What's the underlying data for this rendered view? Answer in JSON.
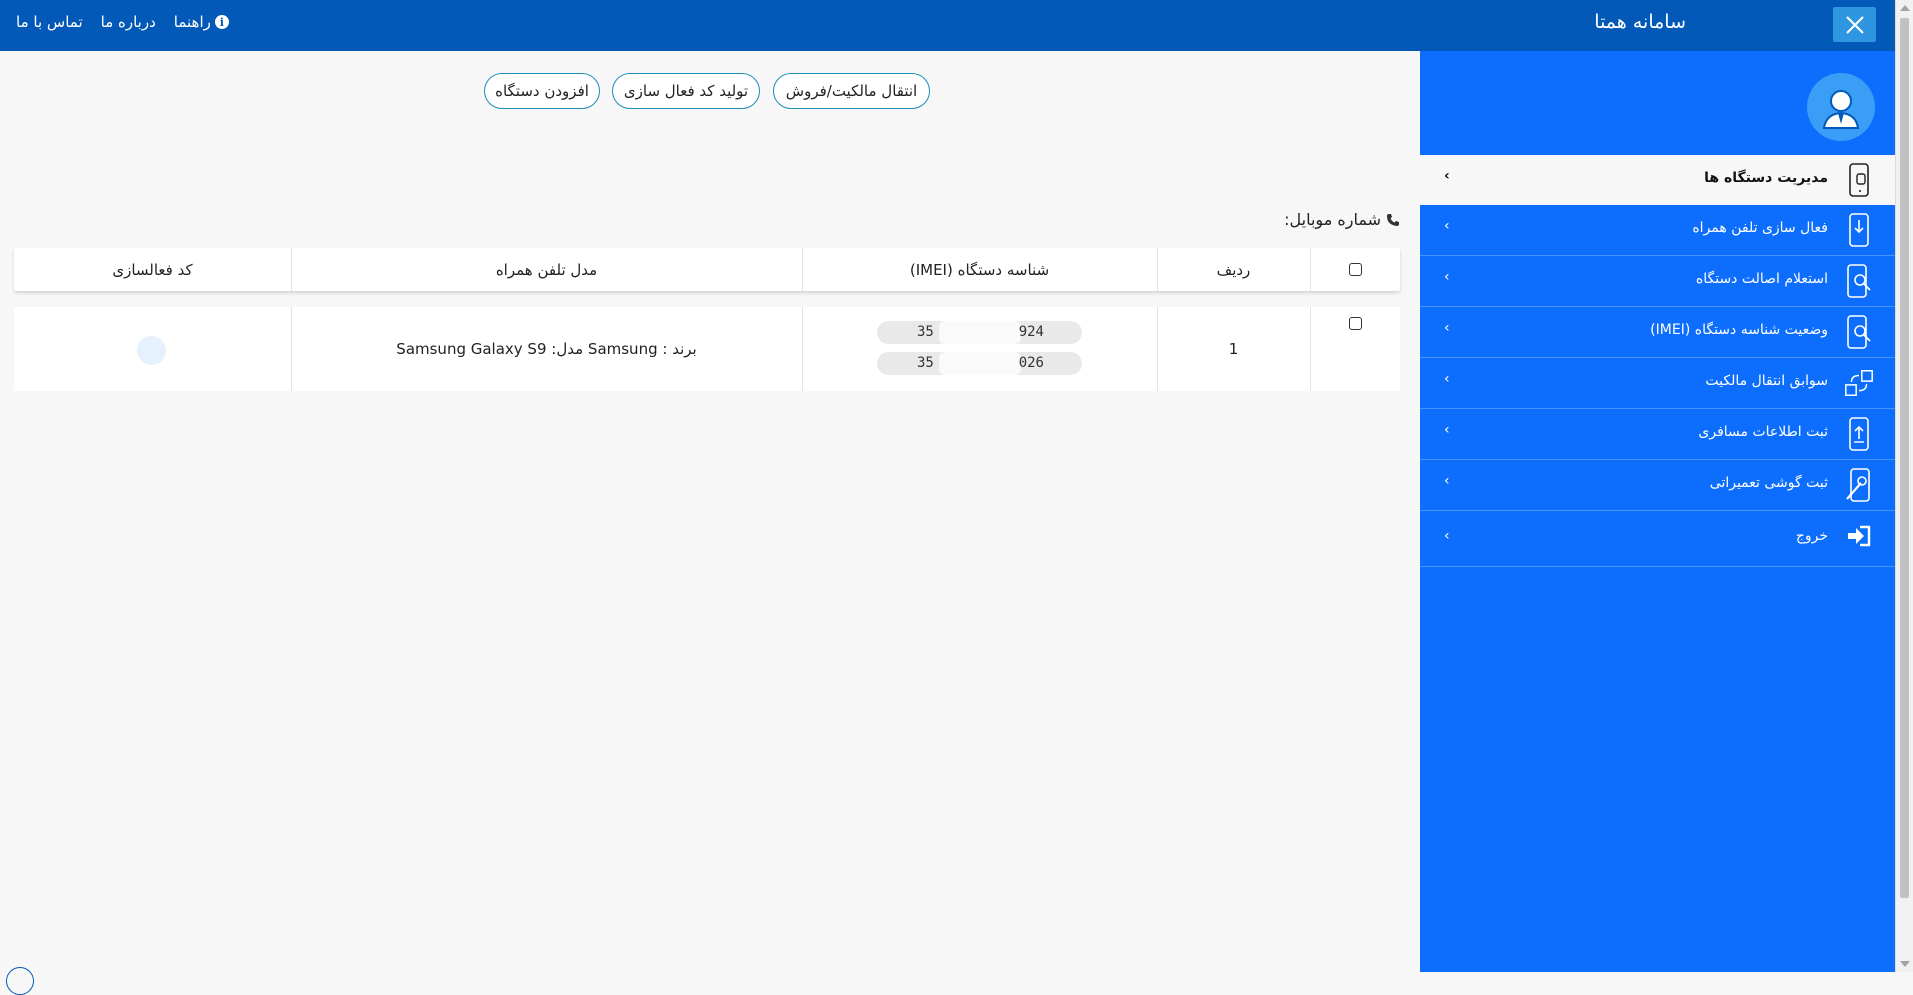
{
  "header": {
    "app_title": "سامانه همتا",
    "links": [
      {
        "label": "راهنما",
        "icon": "info-icon"
      },
      {
        "label": "درباره ما"
      },
      {
        "label": "تماس با ما"
      }
    ]
  },
  "sidebar": {
    "items": [
      {
        "label": "مدیریت دستگاه ها",
        "icon": "phone-manage-icon",
        "active": true
      },
      {
        "label": "فعال سازی تلفن همراه",
        "icon": "phone-download-icon"
      },
      {
        "label": "استعلام اصالت دستگاه",
        "icon": "phone-search-icon"
      },
      {
        "label": "وضعیت شناسه دستگاه (IMEI)",
        "icon": "phone-search-icon"
      },
      {
        "label": "سوابق انتقال مالکیت",
        "icon": "transfer-icon"
      },
      {
        "label": "ثبت اطلاعات مسافری",
        "icon": "phone-upload-icon"
      },
      {
        "label": "ثبت گوشی تعمیراتی",
        "icon": "phone-repair-icon"
      },
      {
        "label": "خروج",
        "icon": "exit-icon"
      }
    ],
    "chevron": "›"
  },
  "actions": {
    "transfer": "انتقال مالکیت/فروش",
    "generate_code": "تولید کد فعال سازی",
    "add_device": "افزودن دستگاه"
  },
  "mobile_label": "شماره موبایل:",
  "table": {
    "headers": {
      "row": "ردیف",
      "imei": "شناسه دستگاه (IMEI)",
      "model": "مدل تلفن همراه",
      "activation": "کد فعالسازی"
    },
    "rows": [
      {
        "index": "1",
        "imei_1_start": "35",
        "imei_1_end": "924",
        "imei_2_start": "35",
        "imei_2_end": "026",
        "model": "برند : Samsung مدل: Samsung Galaxy S9"
      }
    ]
  },
  "colors": {
    "header_bg": "#0259b7",
    "sidebar_bg": "#0d6efd",
    "close_btn": "#2e96e0",
    "button_border": "#1d8fb8"
  }
}
